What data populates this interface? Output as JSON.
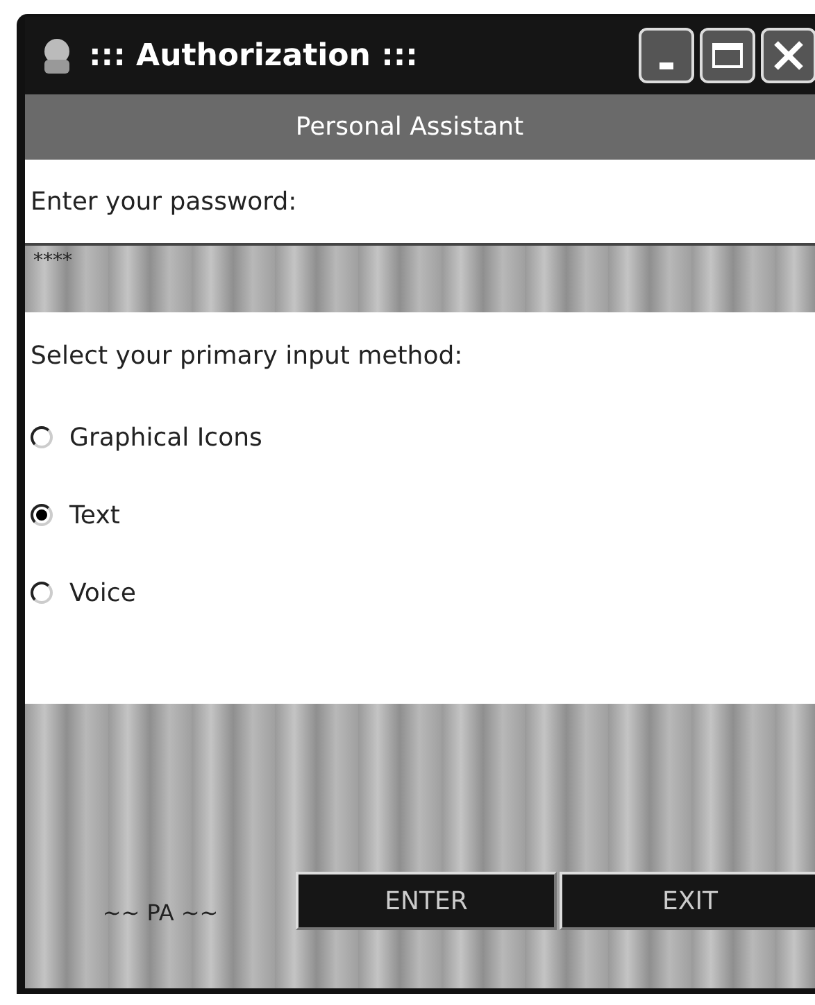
{
  "window": {
    "title": "::: Authorization :::"
  },
  "header": "Personal Assistant",
  "password": {
    "label": "Enter your password:",
    "value": "****"
  },
  "input_method": {
    "label": "Select your primary input method:",
    "options": [
      {
        "label": "Graphical Icons",
        "selected": false
      },
      {
        "label": "Text",
        "selected": true
      },
      {
        "label": "Voice",
        "selected": false
      }
    ]
  },
  "footer": {
    "label": "~~ PA ~~",
    "buttons": [
      "ENTER",
      "EXIT"
    ]
  }
}
